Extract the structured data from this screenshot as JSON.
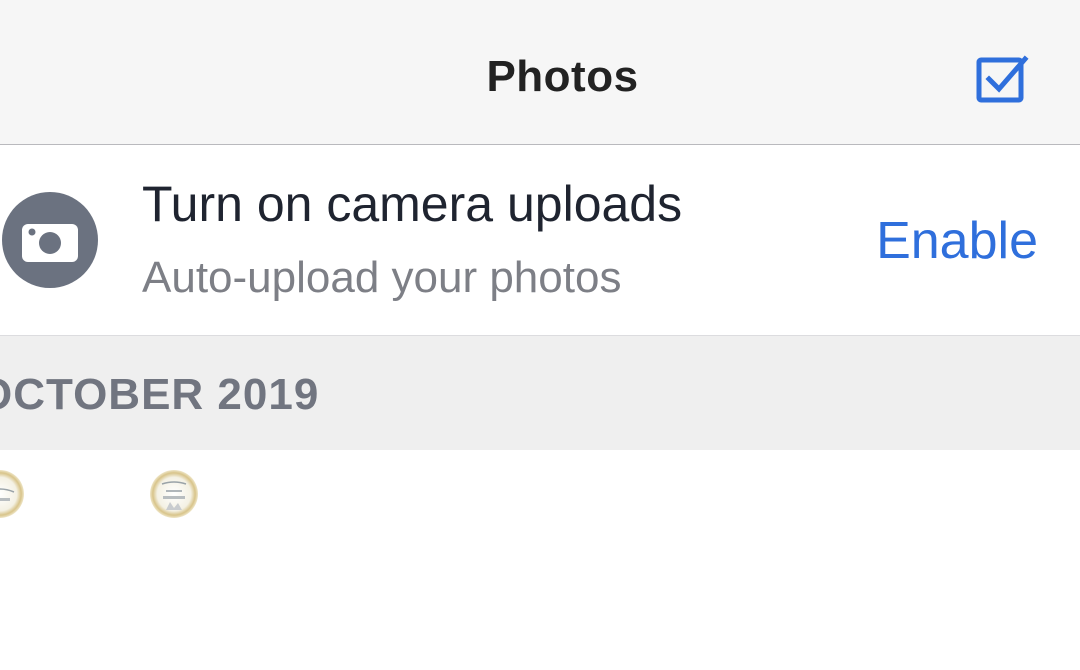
{
  "navbar": {
    "title": "Photos",
    "select_icon": "checkbox-select-icon"
  },
  "camera_uploads": {
    "icon": "camera-icon",
    "title": "Turn on camera uploads",
    "subtitle": "Auto-upload your photos",
    "action_label": "Enable"
  },
  "section": {
    "title": "OCTOBER 2019"
  },
  "colors": {
    "accent": "#2f6fdc",
    "navbar_bg": "#f6f6f6",
    "section_bg": "#efefef",
    "icon_gray": "#6b7280"
  }
}
